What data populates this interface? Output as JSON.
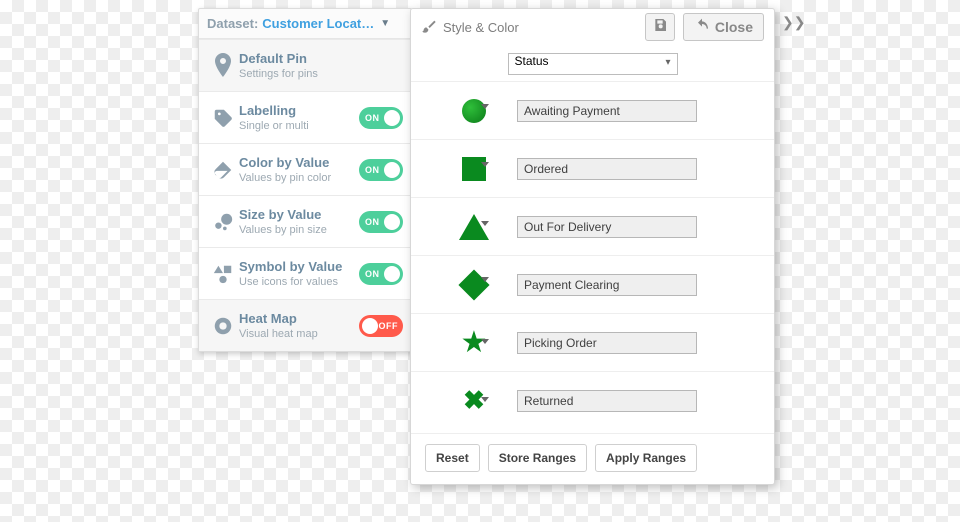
{
  "dataset": {
    "label": "Dataset:",
    "name": "Customer Locati..."
  },
  "menu": [
    {
      "title": "Default Pin",
      "sub": "Settings for pins",
      "toggle": null,
      "icon": "pin"
    },
    {
      "title": "Labelling",
      "sub": "Single or multi",
      "toggle": "ON",
      "icon": "tag"
    },
    {
      "title": "Color by Value",
      "sub": "Values by pin color",
      "toggle": "ON",
      "icon": "paint"
    },
    {
      "title": "Size by Value",
      "sub": "Values by pin size",
      "toggle": "ON",
      "icon": "dots"
    },
    {
      "title": "Symbol by Value",
      "sub": "Use icons for values",
      "toggle": "ON",
      "icon": "shapes"
    },
    {
      "title": "Heat Map",
      "sub": "Visual heat map",
      "toggle": "OFF",
      "icon": "ring"
    }
  ],
  "toggle_labels": {
    "on": "ON",
    "off": "OFF"
  },
  "panel": {
    "title": "Style & Color",
    "close": "Close",
    "field": "Status",
    "rows": [
      {
        "shape": "circle",
        "label": "Awaiting Payment"
      },
      {
        "shape": "square",
        "label": "Ordered"
      },
      {
        "shape": "triangle",
        "label": "Out For Delivery"
      },
      {
        "shape": "diamond",
        "label": "Payment Clearing"
      },
      {
        "shape": "star",
        "label": "Picking Order"
      },
      {
        "shape": "cross",
        "label": "Returned"
      }
    ],
    "buttons": {
      "reset": "Reset",
      "store": "Store Ranges",
      "apply": "Apply Ranges"
    }
  }
}
